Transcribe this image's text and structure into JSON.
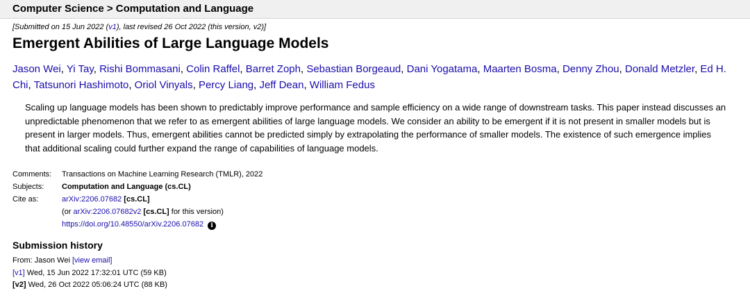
{
  "breadcrumb": {
    "text": "Computer Science > Computation and Language"
  },
  "dateline": {
    "prefix": "[Submitted on 15 Jun 2022 (",
    "v1_link": "v1",
    "suffix": "), last revised 26 Oct 2022 (this version, v2)]"
  },
  "title": "Emergent Abilities of Large Language Models",
  "authors": [
    "Jason Wei",
    "Yi Tay",
    "Rishi Bommasani",
    "Colin Raffel",
    "Barret Zoph",
    "Sebastian Borgeaud",
    "Dani Yogatama",
    "Maarten Bosma",
    "Denny Zhou",
    "Donald Metzler",
    "Ed H. Chi",
    "Tatsunori Hashimoto",
    "Oriol Vinyals",
    "Percy Liang",
    "Jeff Dean",
    "William Fedus"
  ],
  "author_separator": ", ",
  "abstract": "Scaling up language models has been shown to predictably improve performance and sample efficiency on a wide range of downstream tasks. This paper instead discusses an unpredictable phenomenon that we refer to as emergent abilities of large language models. We consider an ability to be emergent if it is not present in smaller models but is present in larger models. Thus, emergent abilities cannot be predicted simply by extrapolating the performance of smaller models. The existence of such emergence implies that additional scaling could further expand the range of capabilities of language models.",
  "metadata": {
    "comments_label": "Comments:",
    "comments_value": "Transactions on Machine Learning Research (TMLR), 2022",
    "subjects_label": "Subjects:",
    "subjects_value": "Computation and Language (cs.CL)",
    "cite_label": "Cite as:",
    "cite_link": "arXiv:2206.07682",
    "cite_tag": "[cs.CL]",
    "cite2_open": "(or ",
    "cite2_link": "arXiv:2206.07682v2",
    "cite2_tag": "[cs.CL]",
    "cite2_suffix": " for this version)",
    "doi_link": "https://doi.org/10.48550/arXiv.2206.07682",
    "doi_icon": "info-icon",
    "doi_icon_glyph": "i"
  },
  "history": {
    "title": "Submission history",
    "from_label": "From: Jason Wei ",
    "view_email": "[view email]",
    "v1_label": "[v1]",
    "v1_text": " Wed, 15 Jun 2022 17:32:01 UTC (59 KB)",
    "v2_label": "[v2]",
    "v2_text": " Wed, 26 Oct 2022 05:06:24 UTC (88 KB)"
  },
  "colors": {
    "link": "#1a0dab",
    "header_bg": "#f0f0f0"
  }
}
